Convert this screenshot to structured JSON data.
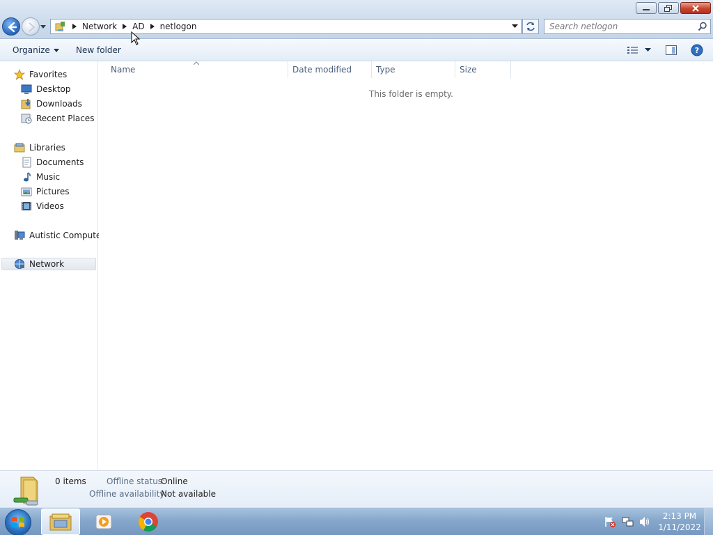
{
  "window": {
    "title": "netlogon",
    "controls": {
      "minimize": "minimize",
      "maximize": "restore",
      "close": "close"
    }
  },
  "address_bar": {
    "breadcrumbs": [
      "Network",
      "AD",
      "netlogon"
    ]
  },
  "search": {
    "placeholder": "Search netlogon"
  },
  "toolbar": {
    "organize_label": "Organize",
    "new_folder_label": "New folder"
  },
  "navigation": {
    "favorites": {
      "label": "Favorites",
      "items": [
        {
          "label": "Desktop",
          "icon": "desktop-icon"
        },
        {
          "label": "Downloads",
          "icon": "downloads-icon"
        },
        {
          "label": "Recent Places",
          "icon": "recent-places-icon"
        }
      ]
    },
    "libraries": {
      "label": "Libraries",
      "items": [
        {
          "label": "Documents",
          "icon": "documents-icon"
        },
        {
          "label": "Music",
          "icon": "music-icon"
        },
        {
          "label": "Pictures",
          "icon": "pictures-icon"
        },
        {
          "label": "Videos",
          "icon": "videos-icon"
        }
      ]
    },
    "computer": {
      "label": "Autistic Computer"
    },
    "network": {
      "label": "Network",
      "selected": true
    }
  },
  "file_list": {
    "columns": [
      "Name",
      "Date modified",
      "Type",
      "Size"
    ],
    "sorted_by": "Name",
    "empty_message": "This folder is empty."
  },
  "details_pane": {
    "item_count": "0 items",
    "offline_status_label": "Offline status:",
    "offline_status_value": "Online",
    "offline_availability_label": "Offline availability:",
    "offline_availability_value": "Not available"
  },
  "taskbar": {
    "pinned": [
      "windows-explorer-icon",
      "media-player-icon",
      "chrome-icon"
    ],
    "clock_time": "2:13 PM",
    "clock_date": "1/11/2022"
  },
  "colors": {
    "accent": "#2f6fc4",
    "title_gradient_top": "#dfe9f5",
    "close_button": "#c7452f",
    "taskbar": "#87a8cc"
  }
}
